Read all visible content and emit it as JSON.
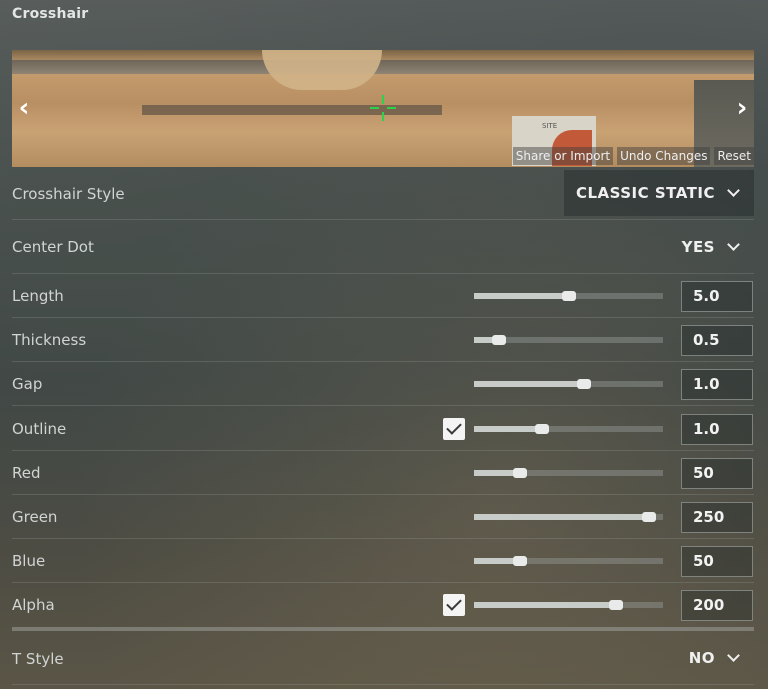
{
  "panel": {
    "title": "Crosshair"
  },
  "preview": {
    "sign_text": "SITE",
    "actions": [
      "Share or Import",
      "Undo Changes",
      "Reset"
    ]
  },
  "dropdowns": {
    "crosshair_style": {
      "label": "Crosshair Style",
      "value": "CLASSIC STATIC"
    },
    "center_dot": {
      "label": "Center Dot",
      "value": "YES"
    },
    "t_style": {
      "label": "T Style",
      "value": "NO"
    }
  },
  "sliders": [
    {
      "label": "Length",
      "value": "5.0",
      "fraction": 0.5,
      "checkbox": false
    },
    {
      "label": "Thickness",
      "value": "0.5",
      "fraction": 0.1,
      "checkbox": false
    },
    {
      "label": "Gap",
      "value": "1.0",
      "fraction": 0.59,
      "checkbox": false
    },
    {
      "label": "Outline",
      "value": "1.0",
      "fraction": 0.35,
      "checkbox": true
    },
    {
      "label": "Red",
      "value": "50",
      "fraction": 0.22,
      "checkbox": false
    },
    {
      "label": "Green",
      "value": "250",
      "fraction": 0.96,
      "checkbox": false
    },
    {
      "label": "Blue",
      "value": "50",
      "fraction": 0.22,
      "checkbox": false
    },
    {
      "label": "Alpha",
      "value": "200",
      "fraction": 0.77,
      "checkbox": true
    }
  ],
  "colors": {
    "crosshair": "#2bd24a",
    "text": "#d0d4d3",
    "value_text": "#f2f2f2"
  }
}
